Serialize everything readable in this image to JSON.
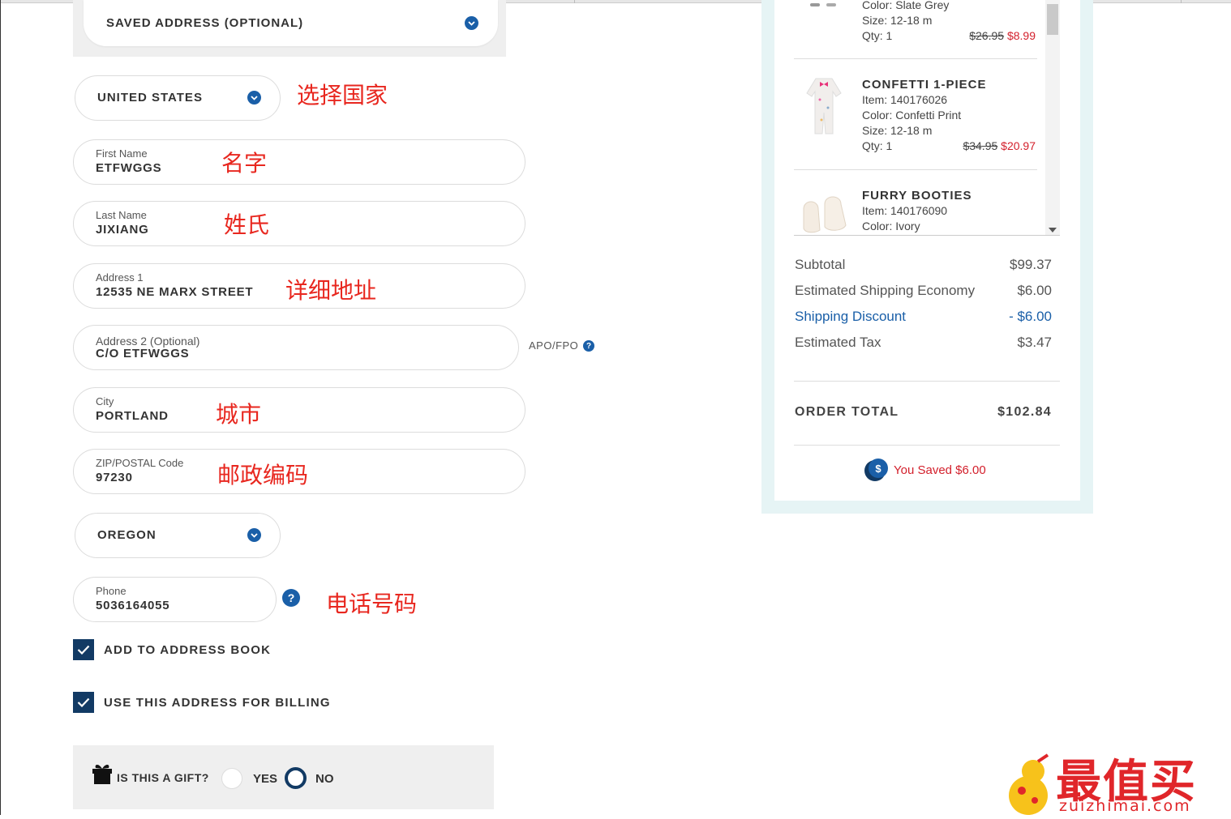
{
  "address_form": {
    "saved_address": "SAVED ADDRESS (OPTIONAL)",
    "country": "UNITED STATES",
    "first_name": {
      "label": "First Name",
      "value": "ETFWGGS"
    },
    "last_name": {
      "label": "Last Name",
      "value": "JIXIANG"
    },
    "address1": {
      "label": "Address 1",
      "value": "12535 NE MARX STREET"
    },
    "address2": {
      "label": "Address 2 (Optional)",
      "value": "C/O ETFWGGS"
    },
    "apo_fpo": "APO/FPO",
    "city": {
      "label": "City",
      "value": "PORTLAND"
    },
    "zip": {
      "label": "ZIP/POSTAL Code",
      "value": "97230"
    },
    "state": "OREGON",
    "phone": {
      "label": "Phone",
      "value": "5036164055"
    },
    "help_glyph": "?",
    "add_to_address_book": "ADD TO ADDRESS BOOK",
    "use_for_billing": "USE THIS ADDRESS FOR BILLING",
    "gift": {
      "question": "IS THIS A GIFT?",
      "yes": "YES",
      "no": "NO",
      "selected": "NO"
    }
  },
  "annotations": {
    "country": "选择国家",
    "first_name": "名字",
    "last_name": "姓氏",
    "address": "详细地址",
    "city": "城市",
    "zip": "邮政编码",
    "phone": "电话号码"
  },
  "cart": {
    "items": [
      {
        "name": "",
        "color": "Color: Slate Grey",
        "size": "Size: 12-18 m",
        "qty": "Qty: 1",
        "list_price": "$26.95",
        "sale_price": "$8.99"
      },
      {
        "name": "CONFETTI 1-PIECE",
        "item": "Item: 140176026",
        "color": "Color: Confetti Print",
        "size": "Size: 12-18 m",
        "qty": "Qty: 1",
        "list_price": "$34.95",
        "sale_price": "$20.97"
      },
      {
        "name": "FURRY BOOTIES",
        "item": "Item: 140176090",
        "color": "Color: Ivory"
      }
    ],
    "summary": {
      "subtotal_label": "Subtotal",
      "subtotal": "$99.37",
      "shipping_label": "Estimated Shipping Economy",
      "shipping": "$6.00",
      "discount_label": "Shipping Discount",
      "discount": "- $6.00",
      "tax_label": "Estimated Tax",
      "tax": "$3.47",
      "total_label": "ORDER TOTAL",
      "total": "$102.84",
      "saved": "You Saved $6.00",
      "saved_icon_glyph": "$"
    }
  },
  "watermark": {
    "main": "最值买",
    "sub": "zuizhimai.com"
  },
  "colors": {
    "accent": "#1a5fa8",
    "checkbox": "#123a64",
    "sale": "#d31f2b",
    "annotation": "#e8271f",
    "panel": "#e6f4f5"
  }
}
